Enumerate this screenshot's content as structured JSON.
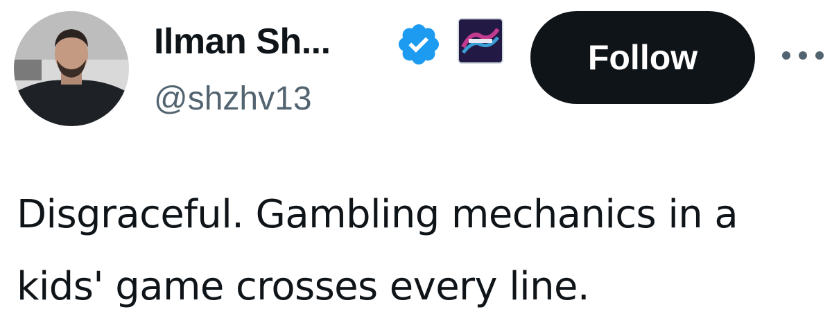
{
  "author": {
    "display_name": "Ilman Sh...",
    "handle": "@shzhv13",
    "verified": true,
    "accent_color": "#1d9bf0"
  },
  "icons": {
    "verified": "verified-badge-icon",
    "affiliate": "affiliate-badge-icon",
    "more": "more-dots-icon"
  },
  "actions": {
    "follow_label": "Follow"
  },
  "tweet": {
    "text": "Disgraceful. Gambling mechanics in a kids' game crosses every line."
  }
}
